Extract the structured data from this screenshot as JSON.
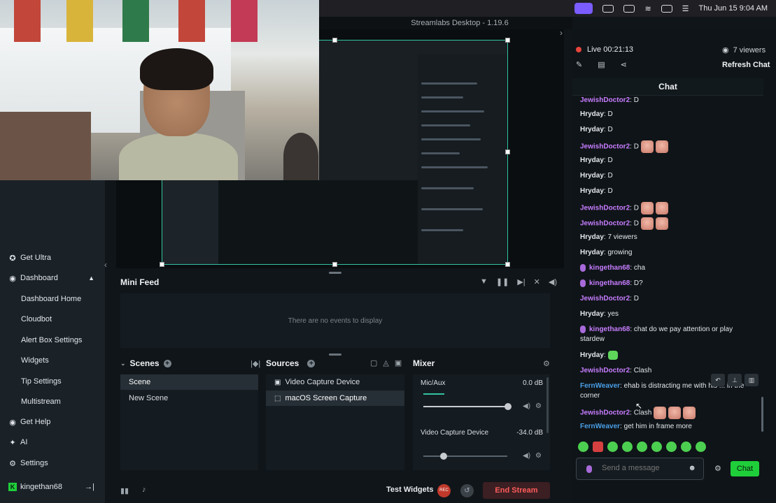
{
  "menubar": {
    "datetime": "Thu Jun 15  9:04 AM"
  },
  "app": {
    "title": "Streamlabs Desktop - 1.19.6"
  },
  "sidebar": {
    "items": [
      {
        "label": "Get Ultra",
        "icon": "ultra-icon"
      },
      {
        "label": "Dashboard",
        "icon": "dashboard-icon"
      },
      {
        "label": "Dashboard Home"
      },
      {
        "label": "Cloudbot"
      },
      {
        "label": "Alert Box Settings"
      },
      {
        "label": "Widgets"
      },
      {
        "label": "Tip Settings"
      },
      {
        "label": "Multistream"
      },
      {
        "label": "Get Help",
        "icon": "help-icon"
      },
      {
        "label": "AI",
        "icon": "ai-icon"
      },
      {
        "label": "Settings",
        "icon": "gear-icon"
      }
    ],
    "user": "kingethan68"
  },
  "minifeed": {
    "title": "Mini Feed",
    "empty": "There are no events to display"
  },
  "scenes": {
    "title": "Scenes",
    "items": [
      "Scene",
      "New Scene"
    ]
  },
  "sources": {
    "title": "Sources",
    "items": [
      "Video Capture Device",
      "macOS Screen Capture"
    ]
  },
  "mixer": {
    "title": "Mixer",
    "channels": [
      {
        "name": "Mic/Aux",
        "db": "0.0 dB",
        "level": 1.0
      },
      {
        "name": "Video Capture Device",
        "db": "-34.0 dB",
        "level": 0.25
      }
    ]
  },
  "footer": {
    "test_widgets": "Test Widgets",
    "rec": "REC",
    "end_stream": "End Stream"
  },
  "chat": {
    "live": "Live 00:21:13",
    "viewers": "7 viewers",
    "refresh": "Refresh Chat",
    "tab": "Chat",
    "input_placeholder": "Send a message",
    "send": "Chat",
    "messages": [
      {
        "user": "JewishDoctor2",
        "text": ": D",
        "color": "#c77dff"
      },
      {
        "user": "Hryday",
        "text": ": D",
        "color": "#e4e8ec"
      },
      {
        "user": "Hryday",
        "text": ": D",
        "color": "#e4e8ec"
      },
      {
        "user": "JewishDoctor2",
        "text": ": D",
        "color": "#c77dff"
      },
      {
        "user": "Hryday",
        "text": ": D",
        "color": "#e4e8ec"
      },
      {
        "user": "Hryday",
        "text": ": D",
        "color": "#e4e8ec"
      },
      {
        "user": "Hryday",
        "text": ": D",
        "color": "#e4e8ec"
      },
      {
        "user": "JewishDoctor2",
        "text": ": D",
        "color": "#c77dff"
      },
      {
        "user": "JewishDoctor2",
        "text": ": D",
        "color": "#c77dff"
      },
      {
        "user": "Hryday",
        "text": ": 7 viewers",
        "color": "#e4e8ec"
      },
      {
        "user": "Hryday",
        "text": ": growing",
        "color": "#e4e8ec"
      },
      {
        "user": "kingethan68",
        "text": ": cha",
        "color": "#c77dff"
      },
      {
        "user": "kingethan68",
        "text": ": D?",
        "color": "#c77dff"
      },
      {
        "user": "JewishDoctor2",
        "text": ": D",
        "color": "#c77dff"
      },
      {
        "user": "Hryday",
        "text": ": yes",
        "color": "#e4e8ec"
      },
      {
        "user": "kingethan68",
        "text": ": chat do we pay attention or play stardew",
        "color": "#c77dff"
      },
      {
        "user": "Hryday",
        "text": ":",
        "color": "#e4e8ec"
      },
      {
        "user": "JewishDoctor2",
        "text": ": Clash",
        "color": "#c77dff"
      },
      {
        "user": "FernWeaver",
        "text": ": ehab is distracting me with his ... in the corner",
        "color": "#4a9fe8"
      },
      {
        "user": "JewishDoctor2",
        "text": ": Clash",
        "color": "#c77dff"
      },
      {
        "user": "FernWeaver",
        "text": ": get him in frame more",
        "color": "#4a9fe8"
      }
    ]
  },
  "colors": {
    "accent": "#31c3a2",
    "live": "#e8453c",
    "send": "#1fcf3a",
    "end_stream": "#ff5c5c"
  }
}
